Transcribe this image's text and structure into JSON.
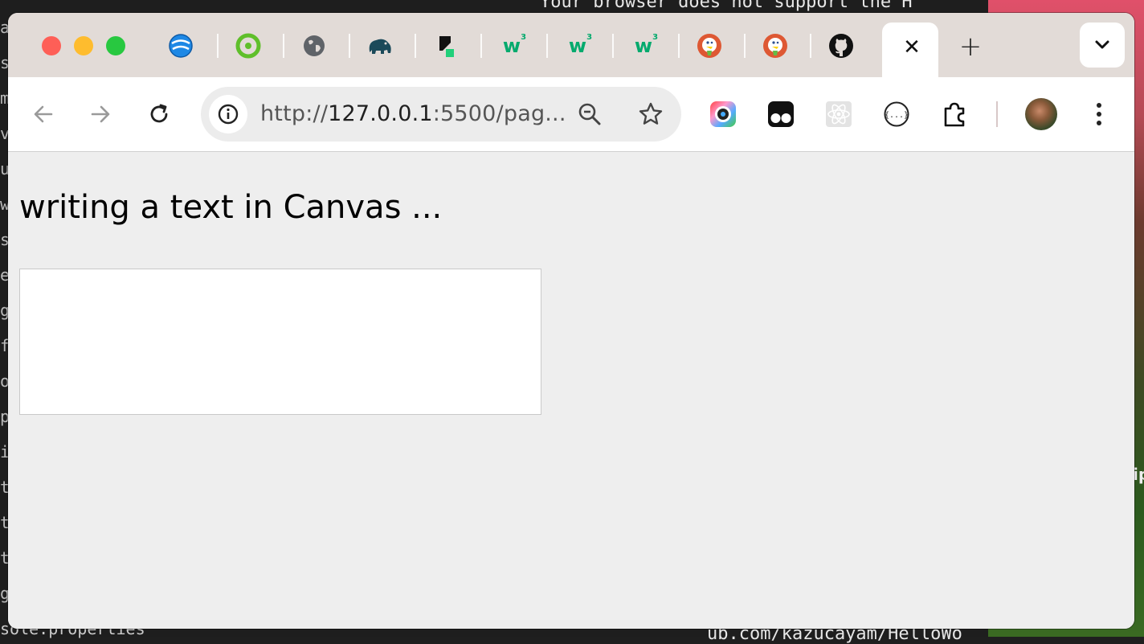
{
  "window": {
    "tabs": [
      {
        "icon": "edge-globe-icon"
      },
      {
        "icon": "rstudio-icon"
      },
      {
        "icon": "globe-icon"
      },
      {
        "icon": "elephant-icon"
      },
      {
        "icon": "stacked-blocks-icon"
      },
      {
        "icon": "w3schools-icon",
        "label": "w",
        "sup": "3"
      },
      {
        "icon": "w3schools-icon",
        "label": "w",
        "sup": "3"
      },
      {
        "icon": "w3schools-icon",
        "label": "w",
        "sup": "3"
      },
      {
        "icon": "duckduckgo-icon"
      },
      {
        "icon": "duckduckgo-icon"
      },
      {
        "icon": "github-icon"
      }
    ],
    "active_tab_close": "✕",
    "new_tab": "+"
  },
  "toolbar": {
    "url_scheme": "http://",
    "url_host": "127.0.0.1",
    "url_rest": ":5500/pag..."
  },
  "page": {
    "heading": "writing a text in Canvas ..."
  },
  "background": {
    "top_code": "Your browser does not support the H",
    "bottom_code": "ub.com/kazucayam/HelloWo",
    "bottom_left": "sole.properties",
    "side_char": "ip",
    "left_chars": [
      "a",
      "s",
      "m",
      "ve",
      "u",
      "w",
      "s",
      "e",
      "gi",
      "fi",
      "o",
      "p",
      "ii",
      "t",
      "t",
      "t",
      "g"
    ]
  },
  "colors": {
    "tabstrip": "#e2dbd7",
    "page_background": "#eeeeee",
    "w3_green": "#04aa6d",
    "traffic_close": "#fe5f57",
    "traffic_min": "#febc2e",
    "traffic_max": "#28c840"
  }
}
